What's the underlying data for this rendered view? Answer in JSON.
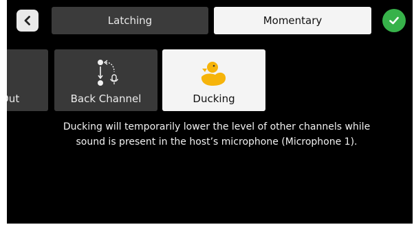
{
  "header": {
    "back_icon": "chevron-left-icon",
    "tabs": [
      {
        "label": "Latching",
        "selected": false
      },
      {
        "label": "Momentary",
        "selected": true
      }
    ],
    "confirm_icon": "checkmark-icon"
  },
  "functions": [
    {
      "label": "Out",
      "icon": "",
      "selected": false
    },
    {
      "label": "Back Channel",
      "icon": "back-channel-icon",
      "selected": false
    },
    {
      "label": "Ducking",
      "icon": "duck-icon",
      "selected": true
    }
  ],
  "description": "Ducking will temporarily lower the level of other channels while sound is present in the host’s microphone (Microphone 1).",
  "colors": {
    "background": "#000000",
    "tab_unselected": "#3b3b3b",
    "tab_selected": "#f4f4f4",
    "confirm_green": "#37b24a",
    "duck_yellow": "#f6b40b"
  }
}
